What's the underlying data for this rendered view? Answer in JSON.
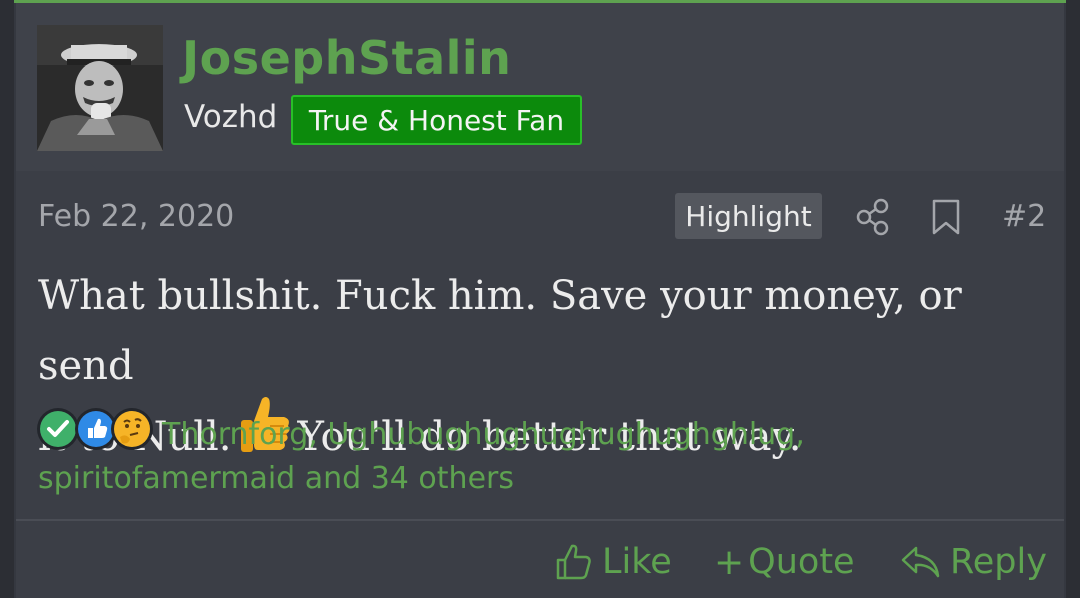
{
  "post": {
    "username": "JosephStalin",
    "user_title": "Vozhd",
    "user_banner": "True & Honest Fan",
    "date": "Feb 22, 2020",
    "highlight_label": "Highlight",
    "post_number": "#2",
    "message_line1": "What bullshit. Fuck him. Save your money, or send",
    "message_line2_a": "it to Null.",
    "message_line2_b": "You'll do better that way.",
    "reaction_names_line1": "Thornforg, Ughubughughughughughghlug,",
    "reaction_names_line2": "spiritofamermaid and 34 others",
    "actions": {
      "like": "Like",
      "quote": "Quote",
      "reply": "Reply"
    }
  },
  "icons": {
    "share": "share-icon",
    "bookmark": "bookmark-icon",
    "thumbs_up_emoji": "thumbs-up-emoji",
    "reaction_check": "check-reaction-icon",
    "reaction_like": "like-reaction-icon",
    "reaction_thinking": "thinking-reaction-icon"
  },
  "colors": {
    "accent": "#5ea250",
    "banner_bg": "#0c8a0c",
    "banner_border": "#28c028",
    "post_bg": "#3b3e46",
    "text": "#ececec"
  }
}
